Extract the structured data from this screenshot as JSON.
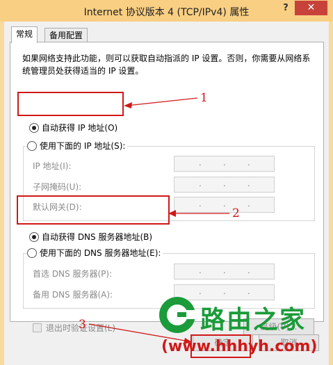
{
  "window": {
    "title": "Internet 协议版本 4 (TCP/IPv4) 属性",
    "help_glyph": "?",
    "close_glyph": "✕"
  },
  "tabs": [
    {
      "label": "常规",
      "active": true
    },
    {
      "label": "备用配置",
      "active": false
    }
  ],
  "general": {
    "description": "如果网络支持此功能，则可以获取自动指派的 IP 设置。否则，你需要从网络系统管理员处获得适当的 IP 设置。",
    "ip_auto_label": "自动获得 IP 地址(O)",
    "ip_manual_label": "使用下面的 IP 地址(S):",
    "ip_fields": [
      {
        "label": "IP 地址(I):",
        "value": ".   .   ."
      },
      {
        "label": "子网掩码(U):",
        "value": ".   .   ."
      },
      {
        "label": "默认网关(D):",
        "value": ".   .   ."
      }
    ],
    "dns_auto_label": "自动获得 DNS 服务器地址(B)",
    "dns_manual_label": "使用下面的 DNS 服务器地址(E):",
    "dns_fields": [
      {
        "label": "首选 DNS 服务器(P):",
        "value": ".   .   ."
      },
      {
        "label": "备用 DNS 服务器(A):",
        "value": ".   .   ."
      }
    ],
    "validate_label": "退出时验证设置(L)",
    "advanced_label": "高级(V)..."
  },
  "footer": {
    "ok_label": "确定",
    "cancel_label": "取消"
  },
  "annotations": {
    "marker_1": "1",
    "marker_2": "2",
    "marker_3": "3",
    "color": "#d01818"
  },
  "watermark": {
    "brand": "路由之家",
    "url": "(www.hhhyh.com)",
    "brand_color": "#1b9b3a"
  }
}
